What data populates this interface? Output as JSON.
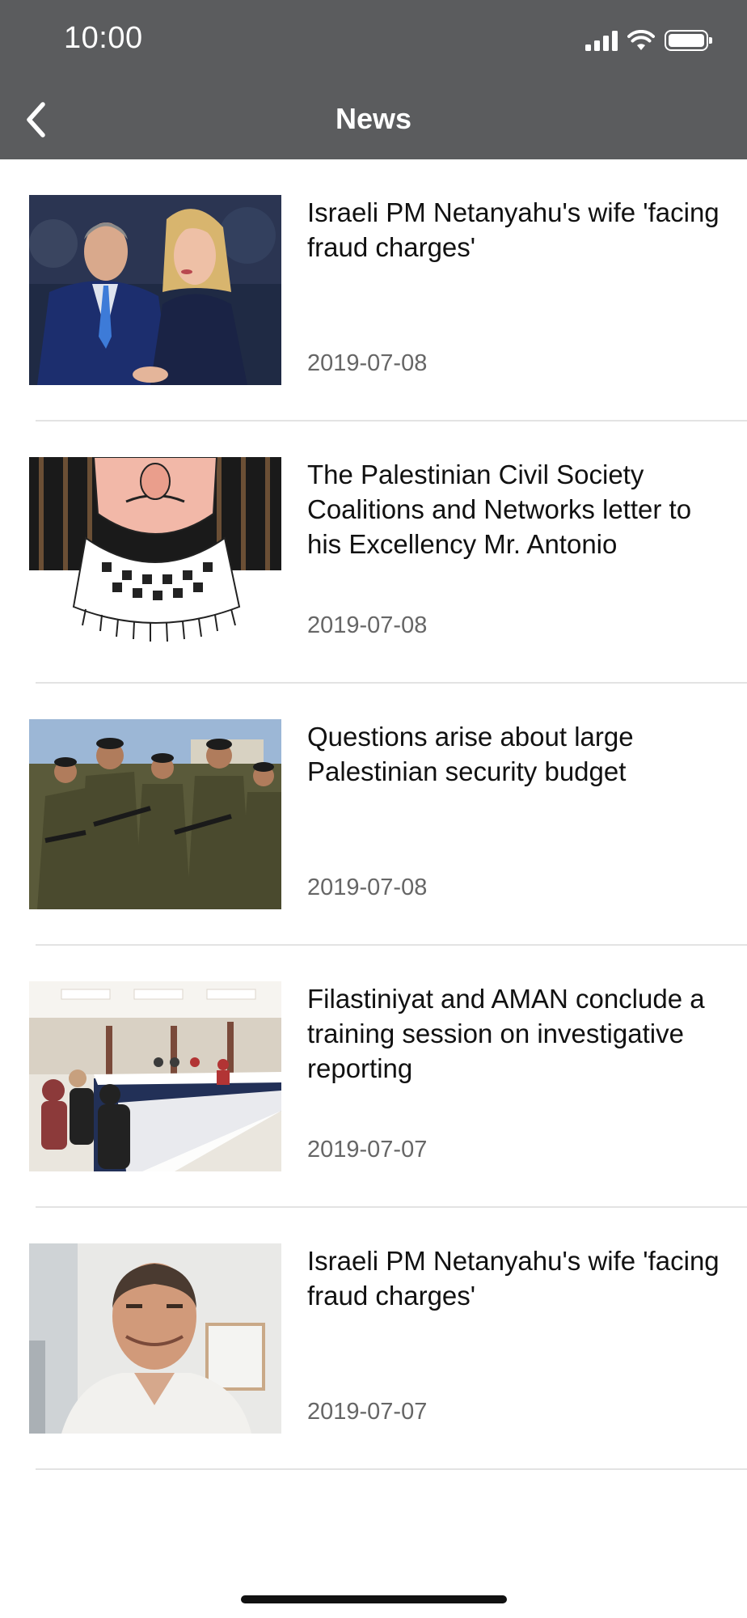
{
  "status_bar": {
    "time": "10:00"
  },
  "nav": {
    "title": "News"
  },
  "news": [
    {
      "title": "Israeli PM Netanyahu's wife 'facing fraud charges'",
      "date": "2019-07-08"
    },
    {
      "title": "The Palestinian Civil Society Coalitions and Networks letter to his Excellency Mr. Antonio",
      "date": "2019-07-08"
    },
    {
      "title": "Questions arise about large Palestinian security budget",
      "date": "2019-07-08"
    },
    {
      "title": "Filastiniyat and AMAN conclude a training session on investigative reporting",
      "date": "2019-07-07"
    },
    {
      "title": "Israeli PM Netanyahu's wife 'facing fraud charges'",
      "date": "2019-07-07"
    }
  ]
}
